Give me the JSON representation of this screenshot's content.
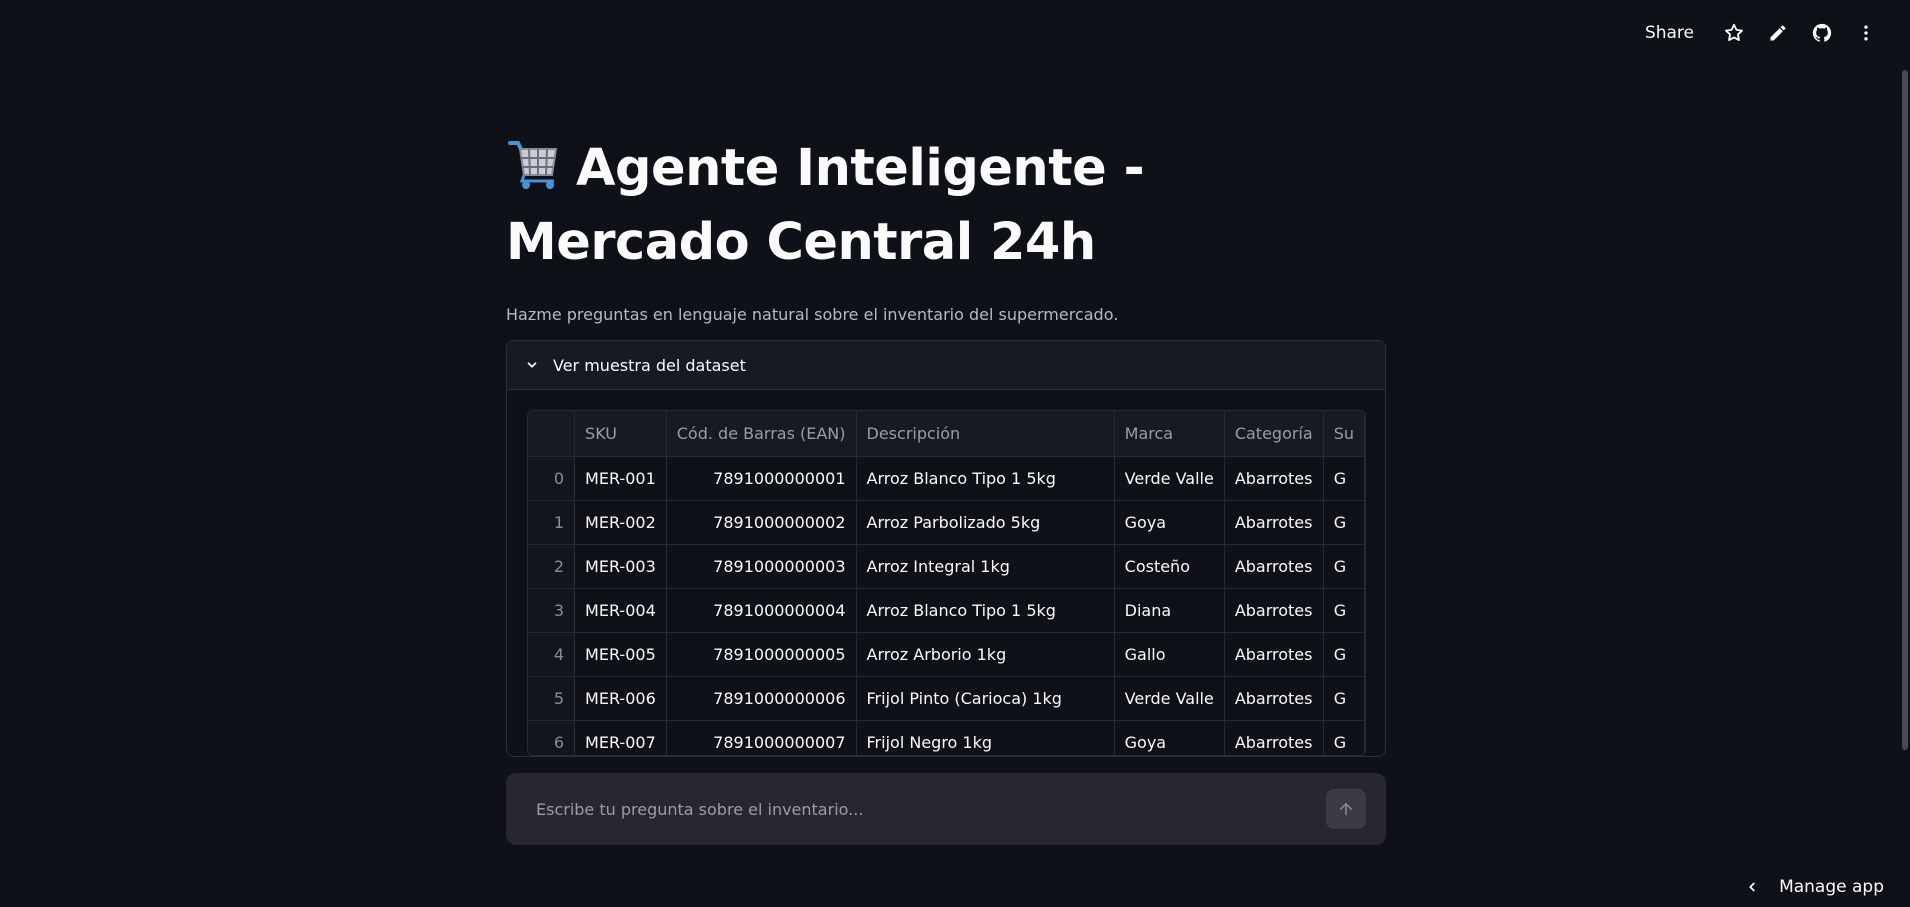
{
  "header": {
    "share_label": "Share",
    "icons": [
      "star-icon",
      "pencil-icon",
      "github-icon",
      "more-vertical-icon"
    ]
  },
  "page": {
    "title_icon": "shopping-cart-emoji",
    "title": "Agente Inteligente - Mercado Central 24h",
    "subtitle": "Hazme preguntas en lenguaje natural sobre el inventario del supermercado."
  },
  "expander": {
    "label": "Ver muestra del dataset",
    "icon": "chevron-down-icon"
  },
  "table": {
    "columns": [
      "",
      "SKU",
      "Cód. de Barras (EAN)",
      "Descripción",
      "Marca",
      "Categoría",
      "Su"
    ],
    "rows": [
      [
        "0",
        "MER-001",
        "7891000000001",
        "Arroz Blanco Tipo 1 5kg",
        "Verde Valle",
        "Abarrotes",
        "G"
      ],
      [
        "1",
        "MER-002",
        "7891000000002",
        "Arroz Parbolizado 5kg",
        "Goya",
        "Abarrotes",
        "G"
      ],
      [
        "2",
        "MER-003",
        "7891000000003",
        "Arroz Integral 1kg",
        "Costeño",
        "Abarrotes",
        "G"
      ],
      [
        "3",
        "MER-004",
        "7891000000004",
        "Arroz Blanco Tipo 1 5kg",
        "Diana",
        "Abarrotes",
        "G"
      ],
      [
        "4",
        "MER-005",
        "7891000000005",
        "Arroz Arborio 1kg",
        "Gallo",
        "Abarrotes",
        "G"
      ],
      [
        "5",
        "MER-006",
        "7891000000006",
        "Frijol Pinto (Carioca) 1kg",
        "Verde Valle",
        "Abarrotes",
        "G"
      ],
      [
        "6",
        "MER-007",
        "7891000000007",
        "Frijol Negro 1kg",
        "Goya",
        "Abarrotes",
        "G"
      ]
    ]
  },
  "chat": {
    "placeholder": "Escribe tu pregunta sobre el inventario...",
    "send_icon": "arrow-up-icon"
  },
  "footer": {
    "manage_label": "Manage app",
    "manage_icon": "chevron-left-icon"
  },
  "colors": {
    "background": "#0e1117",
    "text": "#fafafa",
    "muted": "#9a9ca6",
    "input_bg": "#262730",
    "border": "#262a35"
  }
}
